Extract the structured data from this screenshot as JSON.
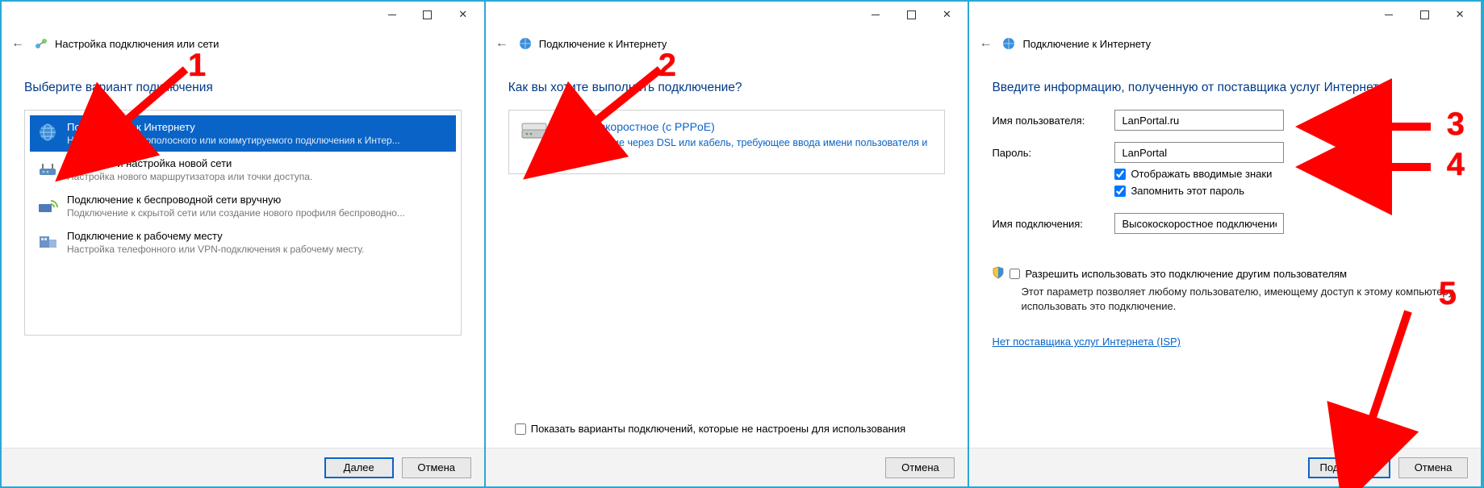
{
  "panel1": {
    "header_title": "Настройка подключения или сети",
    "section_title": "Выберите вариант подключения",
    "items": [
      {
        "title": "Подключение к Интернету",
        "desc": "Настройка широкополосного или коммутируемого подключения к Интер..."
      },
      {
        "title": "Создание и настройка новой сети",
        "desc": "Настройка нового маршрутизатора или точки доступа."
      },
      {
        "title": "Подключение к беспроводной сети вручную",
        "desc": "Подключение к скрытой сети или создание нового профиля беспроводно..."
      },
      {
        "title": "Подключение к рабочему месту",
        "desc": "Настройка телефонного или VPN-подключения к рабочему месту."
      }
    ],
    "next_label": "Далее",
    "cancel_label": "Отмена"
  },
  "panel2": {
    "header_title": "Подключение к Интернету",
    "section_title": "Как вы хотите выполнить подключение?",
    "option_title": "Высокоскоростное (с PPPoE)",
    "option_desc": "Подключение через DSL или кабель, требующее ввода имени пользователя и пароля.",
    "show_unconfigured_label": "Показать варианты подключений, которые не настроены для использования",
    "cancel_label": "Отмена"
  },
  "panel3": {
    "header_title": "Подключение к Интернету",
    "section_title": "Введите информацию, полученную от поставщика услуг Интернета",
    "username_label": "Имя пользователя:",
    "username_value": "LanPortal.ru",
    "password_label": "Пароль:",
    "password_value": "LanPortal",
    "show_chars_label": "Отображать вводимые знаки",
    "remember_label": "Запомнить этот пароль",
    "conn_name_label": "Имя подключения:",
    "conn_name_value": "Высокоскоростное подключение",
    "share_label": "Разрешить использовать это подключение другим пользователям",
    "share_desc": "Этот параметр позволяет любому пользователю, имеющему доступ к этому компьютеру, использовать это подключение.",
    "isp_link": "Нет поставщика услуг Интернета (ISP)",
    "connect_label": "Подключить",
    "cancel_label": "Отмена"
  },
  "annotations": {
    "n1": "1",
    "n2": "2",
    "n3": "3",
    "n4": "4",
    "n5": "5"
  }
}
